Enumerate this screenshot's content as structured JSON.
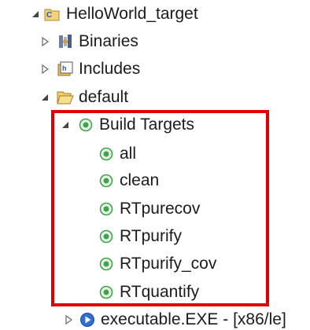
{
  "tree": {
    "items": [
      {
        "label": "HelloWorld_target",
        "icon": "project-folder-icon",
        "expander": "expanded"
      },
      {
        "label": "Binaries",
        "icon": "binaries-icon",
        "expander": "collapsed"
      },
      {
        "label": "Includes",
        "icon": "includes-icon",
        "expander": "collapsed"
      },
      {
        "label": "default",
        "icon": "open-folder-icon",
        "expander": "expanded"
      },
      {
        "label": "Build Targets",
        "icon": "build-target-icon",
        "expander": "expanded"
      },
      {
        "label": "all",
        "icon": "build-target-icon"
      },
      {
        "label": "clean",
        "icon": "build-target-icon"
      },
      {
        "label": "RTpurecov",
        "icon": "build-target-icon"
      },
      {
        "label": "RTpurify",
        "icon": "build-target-icon"
      },
      {
        "label": "RTpurify_cov",
        "icon": "build-target-icon"
      },
      {
        "label": "RTquantify",
        "icon": "build-target-icon"
      },
      {
        "label": "executable.EXE - [x86/le]",
        "icon": "executable-icon",
        "expander": "collapsed"
      }
    ]
  },
  "colors": {
    "highlight": "#e00000",
    "target_green": "#3fa34d",
    "folder_yellow": "#e8c15a",
    "exe_blue": "#2f6fd6"
  }
}
